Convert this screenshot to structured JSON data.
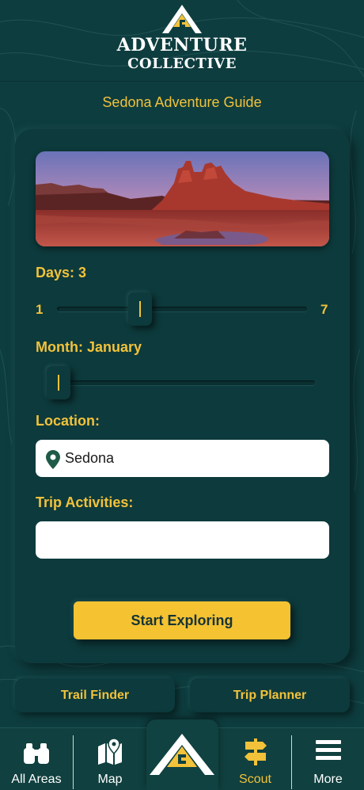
{
  "brand": {
    "line1": "ADVENTURE",
    "line2": "COLLECTIVE"
  },
  "guide": {
    "title": "Sedona Adventure Guide"
  },
  "form": {
    "days_label": "Days: 3",
    "days": {
      "min": "1",
      "max": "7",
      "value": 3
    },
    "month_label": "Month: January",
    "month": {
      "value": 1,
      "min": 1,
      "max": 12
    },
    "location_label": "Location:",
    "location_value": "Sedona",
    "activities_label": "Trip Activities:",
    "activities_value": "",
    "submit_label": "Start Exploring"
  },
  "actions": {
    "trail_finder": "Trail Finder",
    "trip_planner": "Trip Planner"
  },
  "tabbar": {
    "items": [
      {
        "label": "All Areas",
        "icon": "binoculars-icon",
        "active": false
      },
      {
        "label": "Map",
        "icon": "map-icon",
        "active": false
      },
      {
        "label": "",
        "icon": "home-logo-icon",
        "active": false
      },
      {
        "label": "Scout",
        "icon": "signpost-icon",
        "active": true
      },
      {
        "label": "More",
        "icon": "menu-icon",
        "active": false
      }
    ]
  },
  "colors": {
    "background": "#0e3d3f",
    "accent": "#f2c23a",
    "cta": "#f5c232",
    "text_light": "#ffffff"
  }
}
